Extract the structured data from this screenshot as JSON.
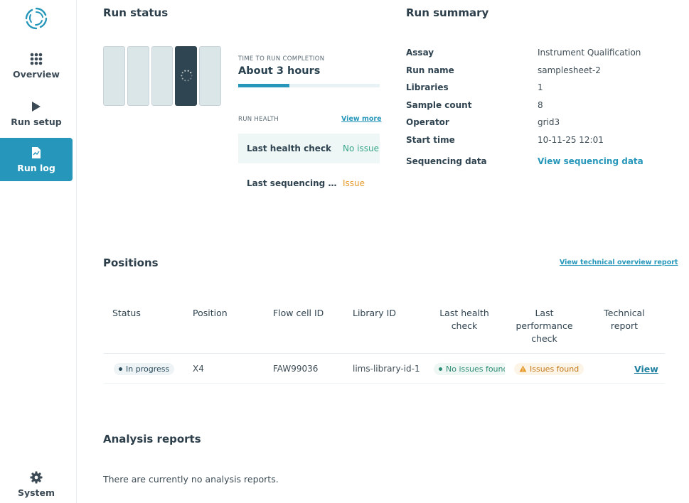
{
  "sidebar": {
    "items": [
      {
        "label": "Overview",
        "icon": "grid-icon"
      },
      {
        "label": "Run setup",
        "icon": "play-icon"
      },
      {
        "label": "Run log",
        "icon": "document-icon",
        "active": true
      }
    ],
    "system_label": "System"
  },
  "run_status": {
    "title": "Run status",
    "time_label": "TIME TO RUN COMPLETION",
    "time_value": "About 3 hours",
    "progress_fraction": 0.36,
    "health_label": "RUN HEALTH",
    "view_more": "View more",
    "health_rows": [
      {
        "label": "Last health check",
        "value": "No issue",
        "status": "ok"
      },
      {
        "label": "Last sequencing perf...",
        "value": "Issue",
        "status": "issue"
      }
    ],
    "active_flowcell_index": 3
  },
  "run_summary": {
    "title": "Run summary",
    "rows": [
      {
        "key": "Assay",
        "value": "Instrument Qualification"
      },
      {
        "key": "Run name",
        "value": "samplesheet-2"
      },
      {
        "key": "Libraries",
        "value": "1"
      },
      {
        "key": "Sample count",
        "value": "8"
      },
      {
        "key": "Operator",
        "value": "grid3"
      },
      {
        "key": "Start time",
        "value": "10-11-25 12:01"
      }
    ],
    "sequencing_data_key": "Sequencing data",
    "sequencing_data_link": "View sequencing data"
  },
  "positions": {
    "title": "Positions",
    "tech_link": "View technical overview report",
    "headers": {
      "status": "Status",
      "position": "Position",
      "flow_cell_id": "Flow cell ID",
      "library_id": "Library ID",
      "last_health_check": "Last health check",
      "last_performance_check": "Last performance check",
      "technical_report": "Technical report"
    },
    "rows": [
      {
        "status": "In progress",
        "position": "X4",
        "flow_cell_id": "FAW99036",
        "library_id": "lims-library-id-1",
        "last_health_check": "No issues found",
        "last_performance_check": "Issues found",
        "technical_report": "View"
      }
    ]
  },
  "analysis_reports": {
    "title": "Analysis reports",
    "empty_text": "There are currently no analysis reports."
  },
  "colors": {
    "accent": "#2697ba",
    "ok": "#3aa68a",
    "issue": "#e69a2c",
    "dark": "#2f4652"
  }
}
